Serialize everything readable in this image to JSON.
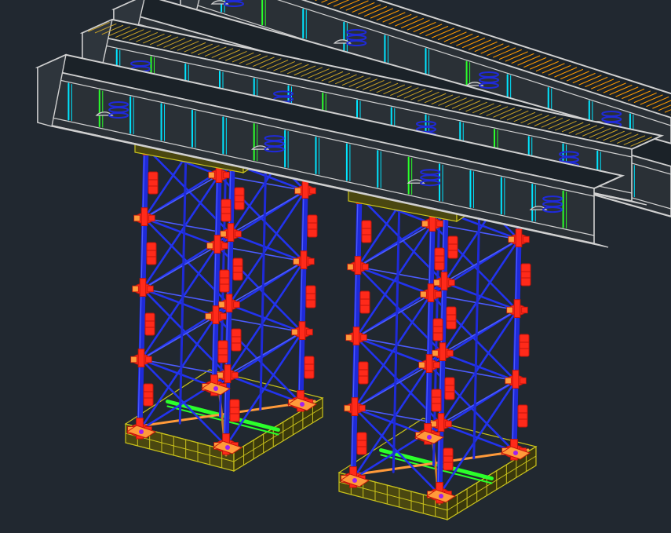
{
  "viewport": {
    "background": "#212830"
  },
  "palette": {
    "beam_outline": "#d0d0d0",
    "beam_web": "#2a3036",
    "stiffener": "#00e5ff",
    "stiffener_alt": "#2bff2b",
    "deck_hatch": "#c9a227",
    "deck_hatch_alt": "#ff9a00",
    "column": "#1f2ad8",
    "column_edge": "#4c5cff",
    "bracing": "#2233ee",
    "coupler": "#ff2a1a",
    "coupler_dark": "#c4140a",
    "base_frame": "#8f8a10",
    "base_frame_edge": "#c9c21c",
    "cross_member": "#2bff2b",
    "plate": "#ff9a3a",
    "anchor": "#a020f0"
  },
  "scene": {
    "beam_count": 4,
    "tower_count": 2,
    "tier_count": 4
  }
}
